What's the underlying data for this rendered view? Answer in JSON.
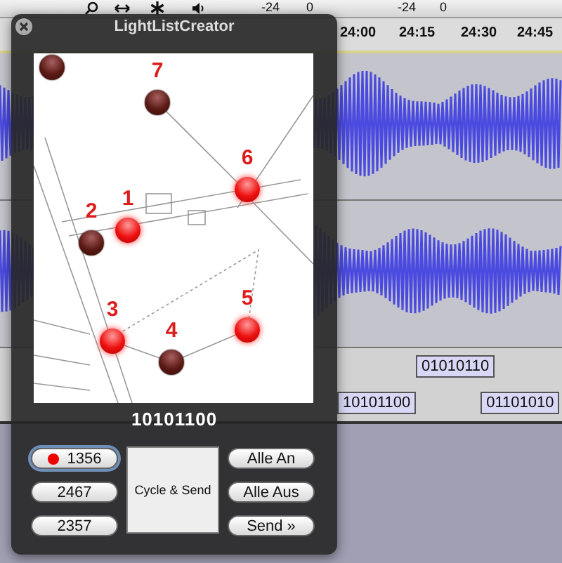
{
  "toolbar": {
    "meter_labels": [
      "-24",
      "0",
      "-24",
      "0"
    ]
  },
  "ruler": {
    "ticks": [
      "24:00",
      "24:15",
      "24:30",
      "24:45"
    ]
  },
  "label_track": {
    "upper_labels": [
      "01010110"
    ],
    "lower_labels": [
      "10101100",
      "01101010"
    ]
  },
  "window": {
    "title": "LightListCreator"
  },
  "map": {
    "lights": [
      {
        "number": "1",
        "on": true
      },
      {
        "number": "2",
        "on": false
      },
      {
        "number": "3",
        "on": true
      },
      {
        "number": "4",
        "on": false
      },
      {
        "number": "5",
        "on": true
      },
      {
        "number": "6",
        "on": true
      },
      {
        "number": "7",
        "on": false
      },
      {
        "on": false
      }
    ]
  },
  "pattern": "10101100",
  "presets": [
    {
      "label": "1356",
      "selected": true
    },
    {
      "label": "2467",
      "selected": false
    },
    {
      "label": "2357",
      "selected": false
    }
  ],
  "cycle_button": "Cycle & Send",
  "actions": [
    "Alle An",
    "Alle Aus",
    "Send »"
  ]
}
